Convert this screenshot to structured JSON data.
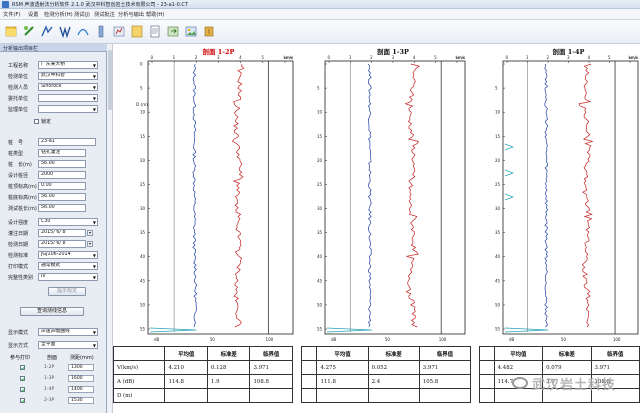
{
  "window": {
    "title": "RSM 声波透射法分析软件 2.1.0  武汉中科智创岩土技术有限公司 - 23-a1-0.CT"
  },
  "menu": [
    "文件(F)",
    "设置",
    "检测分析(H)",
    "测试(J)",
    "测试批注",
    "分析与输出",
    "帮助(H)"
  ],
  "toolbar": {
    "icons": [
      "open-file-icon",
      "save-icon",
      "edit-icon",
      "line-wave-icon",
      "curve-icon",
      "pile-icon",
      "analyze-icon",
      "report-icon",
      "report-doc-icon",
      "export-icon",
      "image-icon",
      "exit-icon"
    ]
  },
  "panel": {
    "header": "分析输出项目栏",
    "fields": [
      {
        "label": "工程名称",
        "value": "广东某大桥",
        "kind": "dropdown"
      },
      {
        "label": "检测单位",
        "value": "武汉中科智",
        "kind": "dropdown"
      },
      {
        "label": "检测人员",
        "value": "Sinorock",
        "kind": "dropdown"
      },
      {
        "label": "委托单位",
        "value": "",
        "kind": "dropdown"
      },
      {
        "label": "监理单位",
        "value": "",
        "kind": "dropdown"
      }
    ],
    "lock_label": "锁定",
    "pile_fields": [
      {
        "label": "桩　号",
        "value": "23-a1"
      },
      {
        "label": "桩类型",
        "value": "钻孔灌注"
      },
      {
        "label": "桩　长(m)",
        "value": "56.00"
      },
      {
        "label": "设计桩径",
        "value": "2000"
      },
      {
        "label": "桩顶标高(m)",
        "value": "0.00"
      },
      {
        "label": "桩底标高(m)",
        "value": "56.00"
      },
      {
        "label": "测试桩长(m)",
        "value": "56.00"
      }
    ],
    "strength": {
      "label": "设计强度",
      "value": "C30"
    },
    "pour_date": {
      "label": "灌注日期",
      "value": "2015/ 6/ 8"
    },
    "test_date": {
      "label": "检测日期",
      "value": "2015/ 6/ 8"
    },
    "standard": {
      "label": "检测标准",
      "value": "JGJ106-2014"
    },
    "print_mode": {
      "label": "打印模式",
      "value": "通常模式"
    },
    "judgement": {
      "label": "完整性类别",
      "value": "IV"
    },
    "disabled_btn": "提示规定",
    "query_btn": "查询测线信息",
    "display_mode": {
      "label": "显示模式",
      "value": "声速声幅曲线"
    },
    "display_style": {
      "label": "显示方式",
      "value": "全平面"
    },
    "table_headers": [
      "参与打印",
      "剖面",
      "测距(mm)"
    ],
    "profiles": [
      {
        "name": "1-2P",
        "dist": "1300",
        "checked": true
      },
      {
        "name": "1-3P",
        "dist": "1600",
        "checked": true
      },
      {
        "name": "1-4P",
        "dist": "1400",
        "checked": true
      },
      {
        "name": "2-3P",
        "dist": "1530",
        "checked": true
      }
    ]
  },
  "charts": [
    {
      "title": "剖面 1-2P",
      "title_color": "#cc0000",
      "stats": {
        "v_mean": "4.210",
        "v_std": "0.128",
        "v_crit": "3.971",
        "a_mean": "114.8",
        "a_std": "1.9",
        "a_crit": "108.8"
      }
    },
    {
      "title": "剖面 1-3P",
      "title_color": "#111111",
      "stats": {
        "v_mean": "4.275",
        "v_std": "0.052",
        "v_crit": "3.971",
        "a_mean": "111.8",
        "a_std": "2.4",
        "a_crit": "105.8"
      }
    },
    {
      "title": "剖面 1-4P",
      "title_color": "#111111",
      "stats": {
        "v_mean": "4.482",
        "v_std": "0.079",
        "v_crit": "3.971",
        "a_mean": "114.7",
        "a_std": "3.0",
        "a_crit": "108.8"
      }
    }
  ],
  "chart_common": {
    "top_ticks": [
      "0",
      "1",
      "2",
      "3",
      "4",
      "5",
      "km/s"
    ],
    "bottom_ticks": [
      "dB",
      "50",
      "100"
    ],
    "depth_label": "D (m)",
    "depth_ticks": [
      "0",
      "5",
      "10",
      "15",
      "20",
      "25",
      "30",
      "35",
      "40",
      "45",
      "50",
      "55"
    ],
    "row_labels": [
      "V(km/s)",
      "A (dB)",
      "D (m)"
    ],
    "col_headers": [
      "平均值",
      "标准差",
      "临界值"
    ]
  },
  "watermark": "武汉岩土科技"
}
